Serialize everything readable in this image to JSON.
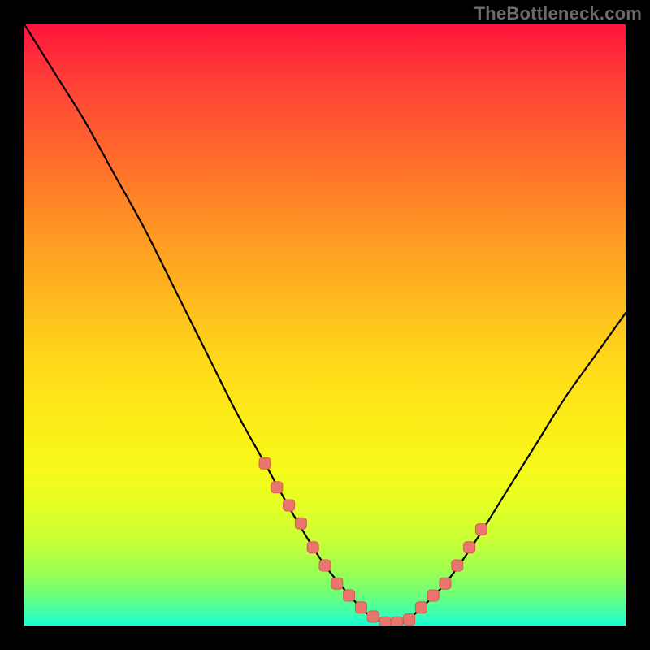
{
  "watermark": "TheBottleneck.com",
  "colors": {
    "page_bg": "#000000",
    "curve": "#000000",
    "marker_fill": "#e9766d",
    "marker_stroke": "#d85b52"
  },
  "chart_data": {
    "type": "line",
    "title": "",
    "xlabel": "",
    "ylabel": "",
    "xlim": [
      0,
      100
    ],
    "ylim": [
      0,
      100
    ],
    "grid": false,
    "legend": false,
    "series": [
      {
        "name": "bottleneck-curve",
        "x": [
          0,
          5,
          10,
          15,
          20,
          25,
          30,
          35,
          40,
          45,
          50,
          55,
          57,
          60,
          63,
          65,
          70,
          75,
          80,
          85,
          90,
          95,
          100
        ],
        "y": [
          100,
          92,
          84,
          75,
          66,
          56,
          46,
          36,
          27,
          18,
          10,
          4,
          2,
          0.5,
          0.5,
          2,
          7,
          14,
          22,
          30,
          38,
          45,
          52
        ]
      }
    ],
    "markers": {
      "name": "highlighted-segment",
      "x": [
        40,
        42,
        44,
        46,
        48,
        50,
        52,
        54,
        56,
        58,
        60,
        62,
        64,
        66,
        68,
        70,
        72,
        74,
        76
      ],
      "y": [
        27,
        23,
        20,
        17,
        13,
        10,
        7,
        5,
        3,
        1.5,
        0.5,
        0.5,
        1,
        3,
        5,
        7,
        10,
        13,
        16
      ]
    }
  }
}
